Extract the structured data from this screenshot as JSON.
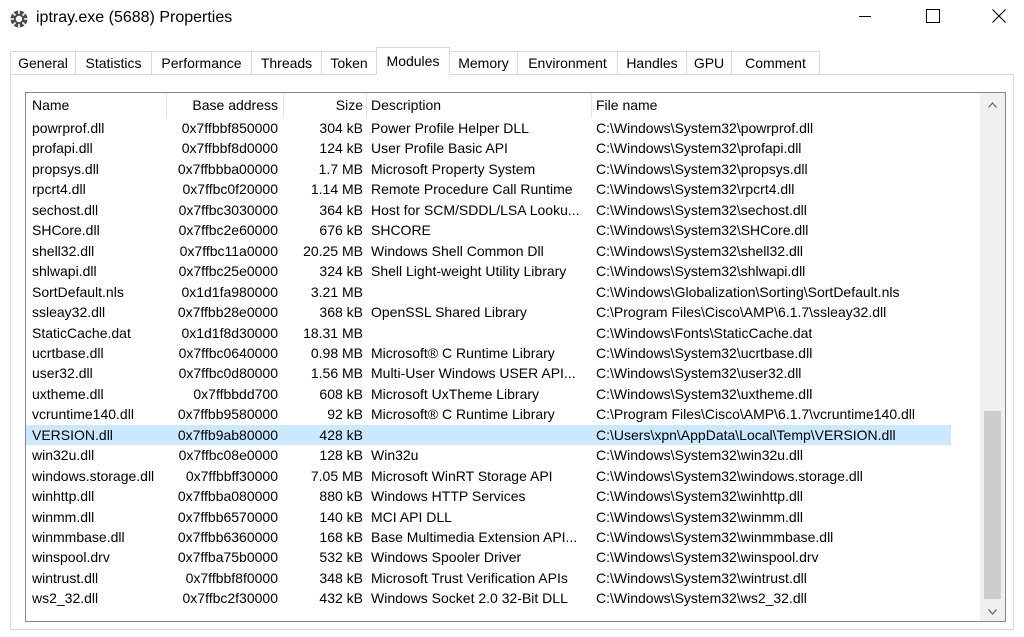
{
  "window": {
    "title": "iptray.exe (5688) Properties"
  },
  "tabs": [
    {
      "label": "General"
    },
    {
      "label": "Statistics"
    },
    {
      "label": "Performance"
    },
    {
      "label": "Threads"
    },
    {
      "label": "Token"
    },
    {
      "label": "Modules",
      "active": true
    },
    {
      "label": "Memory"
    },
    {
      "label": "Environment"
    },
    {
      "label": "Handles"
    },
    {
      "label": "GPU"
    },
    {
      "label": "Comment"
    }
  ],
  "columns": {
    "name": "Name",
    "base": "Base address",
    "size": "Size",
    "desc": "Description",
    "file": "File name"
  },
  "rows": [
    {
      "name": "powrprof.dll",
      "base": "0x7ffbbf850000",
      "size": "304 kB",
      "desc": "Power Profile Helper DLL",
      "file": "C:\\Windows\\System32\\powrprof.dll"
    },
    {
      "name": "profapi.dll",
      "base": "0x7ffbbf8d0000",
      "size": "124 kB",
      "desc": "User Profile Basic API",
      "file": "C:\\Windows\\System32\\profapi.dll"
    },
    {
      "name": "propsys.dll",
      "base": "0x7ffbbba00000",
      "size": "1.7 MB",
      "desc": "Microsoft Property System",
      "file": "C:\\Windows\\System32\\propsys.dll"
    },
    {
      "name": "rpcrt4.dll",
      "base": "0x7ffbc0f20000",
      "size": "1.14 MB",
      "desc": "Remote Procedure Call Runtime",
      "file": "C:\\Windows\\System32\\rpcrt4.dll"
    },
    {
      "name": "sechost.dll",
      "base": "0x7ffbc3030000",
      "size": "364 kB",
      "desc": "Host for SCM/SDDL/LSA Looku...",
      "file": "C:\\Windows\\System32\\sechost.dll"
    },
    {
      "name": "SHCore.dll",
      "base": "0x7ffbc2e60000",
      "size": "676 kB",
      "desc": "SHCORE",
      "file": "C:\\Windows\\System32\\SHCore.dll"
    },
    {
      "name": "shell32.dll",
      "base": "0x7ffbc11a0000",
      "size": "20.25 MB",
      "desc": "Windows Shell Common Dll",
      "file": "C:\\Windows\\System32\\shell32.dll"
    },
    {
      "name": "shlwapi.dll",
      "base": "0x7ffbc25e0000",
      "size": "324 kB",
      "desc": "Shell Light-weight Utility Library",
      "file": "C:\\Windows\\System32\\shlwapi.dll"
    },
    {
      "name": "SortDefault.nls",
      "base": "0x1d1fa980000",
      "size": "3.21 MB",
      "desc": "",
      "file": "C:\\Windows\\Globalization\\Sorting\\SortDefault.nls"
    },
    {
      "name": "ssleay32.dll",
      "base": "0x7ffbb28e0000",
      "size": "368 kB",
      "desc": "OpenSSL Shared Library",
      "file": "C:\\Program Files\\Cisco\\AMP\\6.1.7\\ssleay32.dll"
    },
    {
      "name": "StaticCache.dat",
      "base": "0x1d1f8d30000",
      "size": "18.31 MB",
      "desc": "",
      "file": "C:\\Windows\\Fonts\\StaticCache.dat"
    },
    {
      "name": "ucrtbase.dll",
      "base": "0x7ffbc0640000",
      "size": "0.98 MB",
      "desc": "Microsoft® C Runtime Library",
      "file": "C:\\Windows\\System32\\ucrtbase.dll"
    },
    {
      "name": "user32.dll",
      "base": "0x7ffbc0d80000",
      "size": "1.56 MB",
      "desc": "Multi-User Windows USER API...",
      "file": "C:\\Windows\\System32\\user32.dll"
    },
    {
      "name": "uxtheme.dll",
      "base": "0x7ffbbdd700",
      "size": "608 kB",
      "desc": "Microsoft UxTheme Library",
      "file": "C:\\Windows\\System32\\uxtheme.dll"
    },
    {
      "name": "vcruntime140.dll",
      "base": "0x7ffbb9580000",
      "size": "92 kB",
      "desc": "Microsoft® C Runtime Library",
      "file": "C:\\Program Files\\Cisco\\AMP\\6.1.7\\vcruntime140.dll"
    },
    {
      "name": "VERSION.dll",
      "base": "0x7ffb9ab80000",
      "size": "428 kB",
      "desc": "",
      "file": "C:\\Users\\xpn\\AppData\\Local\\Temp\\VERSION.dll",
      "selected": true
    },
    {
      "name": "win32u.dll",
      "base": "0x7ffbc08e0000",
      "size": "128 kB",
      "desc": "Win32u",
      "file": "C:\\Windows\\System32\\win32u.dll"
    },
    {
      "name": "windows.storage.dll",
      "base": "0x7ffbbff30000",
      "size": "7.05 MB",
      "desc": "Microsoft WinRT Storage API",
      "file": "C:\\Windows\\System32\\windows.storage.dll"
    },
    {
      "name": "winhttp.dll",
      "base": "0x7ffbba080000",
      "size": "880 kB",
      "desc": "Windows HTTP Services",
      "file": "C:\\Windows\\System32\\winhttp.dll"
    },
    {
      "name": "winmm.dll",
      "base": "0x7ffbb6570000",
      "size": "140 kB",
      "desc": "MCI API DLL",
      "file": "C:\\Windows\\System32\\winmm.dll"
    },
    {
      "name": "winmmbase.dll",
      "base": "0x7ffbb6360000",
      "size": "168 kB",
      "desc": "Base Multimedia Extension API...",
      "file": "C:\\Windows\\System32\\winmmbase.dll"
    },
    {
      "name": "winspool.drv",
      "base": "0x7ffba75b0000",
      "size": "532 kB",
      "desc": "Windows Spooler Driver",
      "file": "C:\\Windows\\System32\\winspool.drv"
    },
    {
      "name": "wintrust.dll",
      "base": "0x7ffbbf8f0000",
      "size": "348 kB",
      "desc": "Microsoft Trust Verification APIs",
      "file": "C:\\Windows\\System32\\wintrust.dll"
    },
    {
      "name": "ws2_32.dll",
      "base": "0x7ffbc2f30000",
      "size": "432 kB",
      "desc": "Windows Socket 2.0 32-Bit DLL",
      "file": "C:\\Windows\\System32\\ws2_32.dll"
    }
  ],
  "colors": {
    "selection": "#cce8ff",
    "scroll_thumb": "#cdcdcd"
  },
  "icons": {
    "app": "gear-icon",
    "minimize": "minimize-icon",
    "maximize": "maximize-icon",
    "close": "close-icon"
  }
}
